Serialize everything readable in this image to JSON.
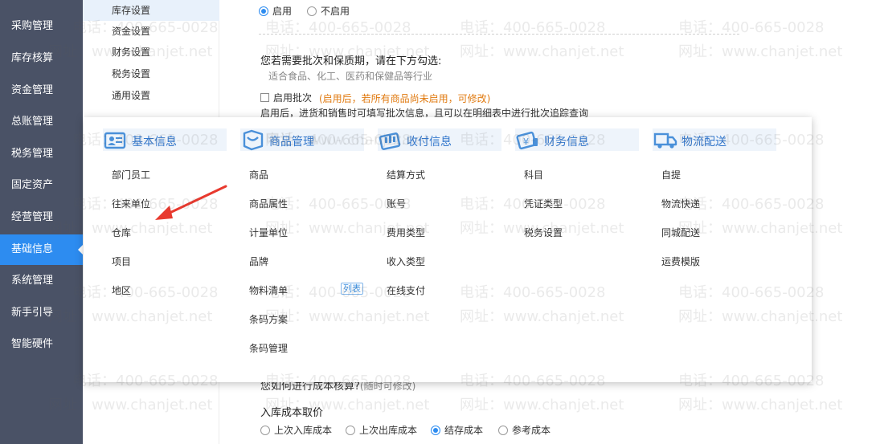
{
  "sidebar": {
    "items": [
      {
        "label": "采购管理"
      },
      {
        "label": "库存核算"
      },
      {
        "label": "资金管理"
      },
      {
        "label": "总账管理"
      },
      {
        "label": "税务管理"
      },
      {
        "label": "固定资产"
      },
      {
        "label": "经营管理"
      },
      {
        "label": "基础信息",
        "active": true
      },
      {
        "label": "系统管理"
      },
      {
        "label": "新手引导"
      },
      {
        "label": "智能硬件"
      }
    ]
  },
  "submenu": {
    "items": [
      {
        "label": "库存设置",
        "active": true
      },
      {
        "label": "资金设置"
      },
      {
        "label": "财务设置"
      },
      {
        "label": "税务设置"
      },
      {
        "label": "通用设置"
      }
    ]
  },
  "settings": {
    "enable_label": "启用",
    "disable_label": "不启用",
    "batch_heading": "您若需要批次和保质期，请在下方勾选:",
    "batch_hint": "适合食品、化工、医药和保健品等行业",
    "batch_checkbox_label": "启用批次",
    "batch_note": "(启用后，若所有商品尚未启用，可修改)",
    "batch_desc": "启用后，进货和销售时可填写批次信息，且可以在明细表中进行批次追踪查询",
    "cost_partial": "您如何进行成本核算?",
    "cost_partial_note": "(随时可修改)",
    "inbound_cost_label": "入库成本取价",
    "inbound_options": [
      "上次入库成本",
      "上次出库成本",
      "结存成本",
      "参考成本"
    ],
    "inbound_selected_index": 2
  },
  "mega_menu": {
    "columns": [
      {
        "title": "基本信息",
        "icon": "basic-info-icon",
        "items": [
          "部门员工",
          "往来单位",
          "仓库",
          "项目",
          "地区"
        ]
      },
      {
        "title": "商品管理",
        "icon": "product-icon",
        "items": [
          "商品",
          "商品属性",
          "计量单位",
          "品牌",
          "物料清单",
          "条码方案",
          "条码管理"
        ],
        "tag": "列表"
      },
      {
        "title": "收付信息",
        "icon": "payment-icon",
        "items": [
          "结算方式",
          "账号",
          "费用类型",
          "收入类型",
          "在线支付"
        ]
      },
      {
        "title": "财务信息",
        "icon": "finance-icon",
        "items": [
          "科目",
          "凭证类型",
          "税务设置"
        ]
      },
      {
        "title": "物流配送",
        "icon": "truck-icon",
        "items": [
          "自提",
          "物流快递",
          "同城配送",
          "运费模版"
        ]
      }
    ]
  },
  "watermark": {
    "phone": "电话：400-665-0028",
    "site": "网址：www.chanjet.net"
  },
  "colors": {
    "sidebar_bg": "#4a5266",
    "active_blue": "#2d8cf0",
    "note_orange": "#e07a10",
    "arrow_red": "#e8392e"
  }
}
